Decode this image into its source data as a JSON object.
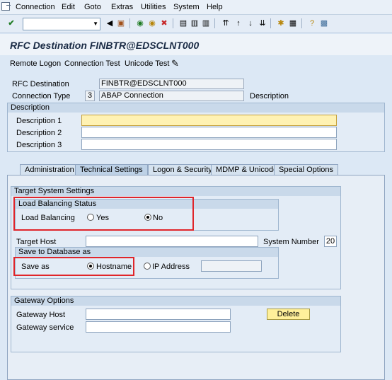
{
  "menubar": {
    "items": [
      "Connection",
      "Edit",
      "Goto",
      "Extras",
      "Utilities",
      "System",
      "Help"
    ]
  },
  "toolbar": {
    "command_field": "",
    "icons": [
      "check-icon",
      "back-icon",
      "save-icon",
      "back-nav-icon",
      "exit-icon",
      "cancel-icon",
      "print-icon",
      "find-icon",
      "find-next-icon",
      "first-page-icon",
      "prev-page-icon",
      "next-page-icon",
      "last-page-icon",
      "new-session-icon",
      "shortcut-icon",
      "help-icon",
      "layout-icon"
    ]
  },
  "title": "RFC Destination FINBTR@EDSCLNT000",
  "app_toolbar": {
    "remote_logon": "Remote Logon",
    "connection_test": "Connection Test",
    "unicode_test": "Unicode Test"
  },
  "header": {
    "rfc_destination_label": "RFC Destination",
    "rfc_destination_value": "FINBTR@EDSCLNT000",
    "connection_type_label": "Connection Type",
    "connection_type_code": "3",
    "connection_type_value": "ABAP Connection",
    "description_label": "Description"
  },
  "description": {
    "section_title": "Description",
    "desc1_label": "Description 1",
    "desc2_label": "Description 2",
    "desc3_label": "Description 3",
    "desc1_value": "",
    "desc2_value": "",
    "desc3_value": ""
  },
  "tabs": [
    "Administration",
    "Technical Settings",
    "Logon & Security",
    "MDMP & Unicode",
    "Special Options"
  ],
  "active_tab": "Technical Settings",
  "target_system": {
    "section_title": "Target System Settings",
    "load_balancing_status_title": "Load Balancing Status",
    "load_balancing_label": "Load Balancing",
    "yes_label": "Yes",
    "no_label": "No",
    "target_host_label": "Target Host",
    "target_host_value": "",
    "system_number_label": "System Number",
    "system_number_value": "20",
    "save_to_db_title": "Save to Database as",
    "save_as_label": "Save as",
    "hostname_label": "Hostname",
    "ip_address_label": "IP Address",
    "ip_value": ""
  },
  "gateway": {
    "section_title": "Gateway Options",
    "host_label": "Gateway Host",
    "service_label": "Gateway service",
    "host_value": "",
    "service_value": "",
    "delete_label": "Delete"
  },
  "colors": {
    "highlight": "#e0252a",
    "active_input": "#fff2b3",
    "background": "#dce8f5"
  }
}
